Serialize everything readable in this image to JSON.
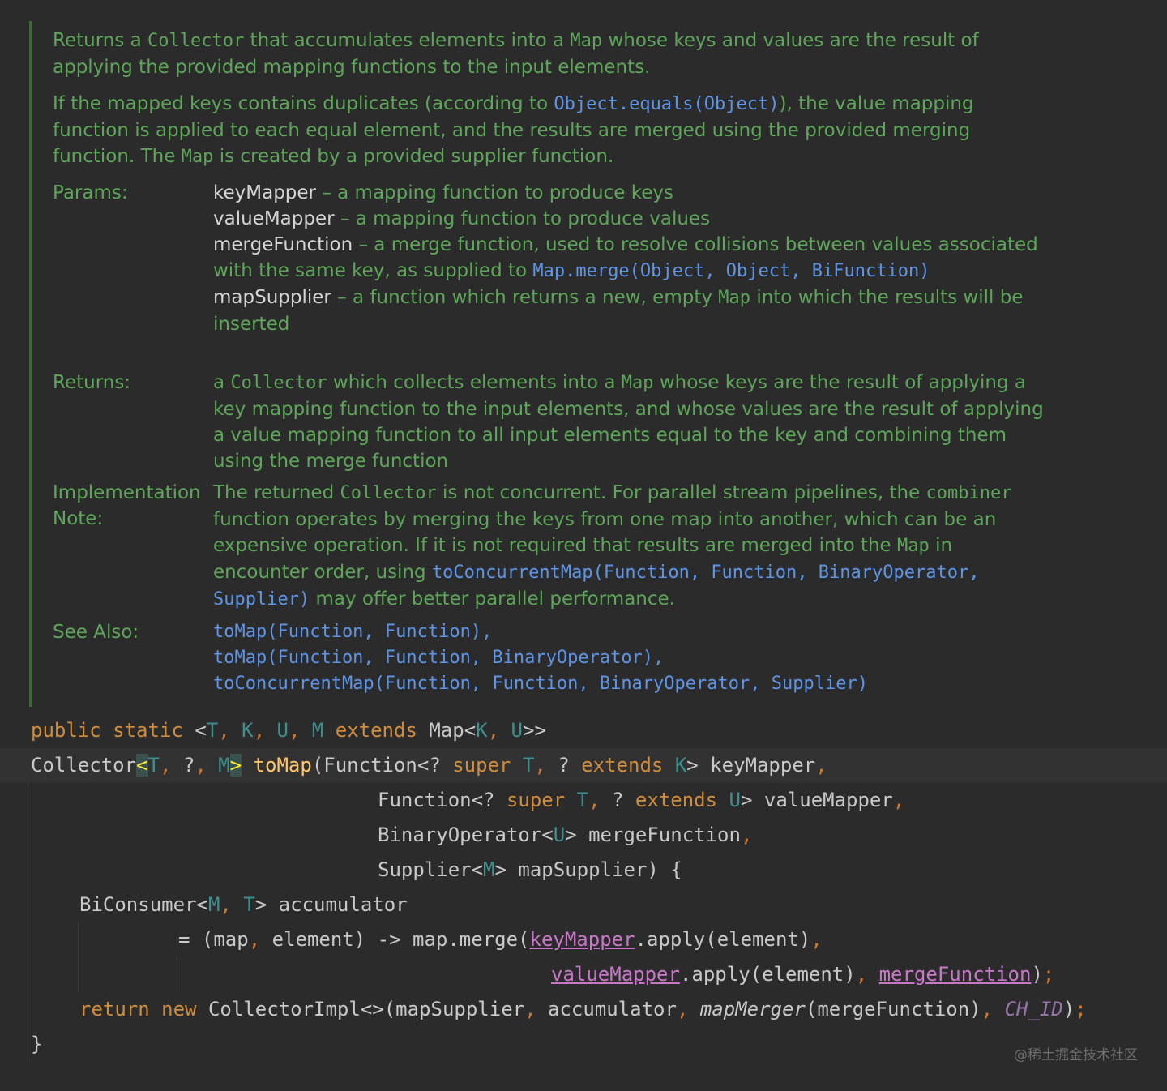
{
  "doc": {
    "p1_a": "Returns a ",
    "p1_b": "Collector",
    "p1_c": " that accumulates elements into a ",
    "p1_d": "Map",
    "p1_e": " whose keys and values are the result of applying the provided mapping functions to the input elements.",
    "p2_a": "If the mapped keys contains duplicates (according to ",
    "p2_link": "Object.equals(Object)",
    "p2_b": "), the value mapping function is applied to each equal element, and the results are merged using the provided merging function. The ",
    "p2_map": "Map",
    "p2_c": " is created by a provided supplier function.",
    "params_label": "Params:",
    "params": [
      {
        "name": "keyMapper",
        "desc": " – a mapping function to produce keys"
      },
      {
        "name": "valueMapper",
        "desc": " – a mapping function to produce values"
      },
      {
        "name": "mergeFunction",
        "desc": " – a merge function, used to resolve collisions between values associated with the same key, as supplied to ",
        "link": "Map.merge(Object, Object, BiFunction)"
      },
      {
        "name": "mapSupplier",
        "desc": " – a function which returns a new, empty ",
        "code": "Map",
        "desc2": " into which the results will be inserted"
      }
    ],
    "returns_label": "Returns:",
    "returns_a": "a ",
    "returns_collector": "Collector",
    "returns_b": " which collects elements into a ",
    "returns_map": "Map",
    "returns_c": " whose keys are the result of applying a key mapping function to the input elements, and whose values are the result of applying a value mapping function to all input elements equal to the key and combining them using the merge function",
    "impl_label_1": "Implementation",
    "impl_label_2": "Note:",
    "impl_a": "The returned ",
    "impl_collector": "Collector",
    "impl_b": " is not concurrent. For parallel stream pipelines, the ",
    "impl_combiner": "combiner",
    "impl_c": " function operates by merging the keys from one map into another, which can be an expensive operation. If it is not required that results are merged into the ",
    "impl_map": "Map",
    "impl_d": " in encounter order, using ",
    "impl_link": "toConcurrentMap(Function, Function, BinaryOperator, Supplier)",
    "impl_e": " may offer better parallel performance.",
    "see_label": "See Also:",
    "see": [
      "toMap(Function, Function),",
      "toMap(Function, Function, BinaryOperator),",
      "toConcurrentMap(Function, Function, BinaryOperator, Supplier)"
    ]
  },
  "code": {
    "public": "public",
    "static": "static",
    "lt": "<",
    "T": "T",
    "K": "K",
    "U": "U",
    "M": "M",
    "comma": ",",
    "extends": "extends",
    "Map": "Map",
    "gtgt": ">>",
    "Collector": "Collector",
    "q": "?",
    "gt": ">",
    "toMap": "toMap",
    "Function": "Function",
    "q_open": "(Function<?",
    "super": "super",
    "keyMapper": "keyMapper",
    "valueMapper": "valueMapper",
    "BinaryOperator": "BinaryOperator",
    "mergeFunction": "mergeFunction",
    "Supplier": "Supplier",
    "mapSupplier": "mapSupplier",
    "brace_open": ") {",
    "BiConsumer": "BiConsumer",
    "accumulator": "accumulator",
    "eq": "= ",
    "lambda_a": "(map",
    "lambda_b": " element) -> map.merge(",
    "apply_element": ".apply(element)",
    "semicolon": ";",
    "close_paren": ")",
    "return": "return",
    "new": "new",
    "CollectorImpl": "CollectorImpl<>(mapSupplier",
    "accumulator2": " accumulator",
    "mapMerger": "mapMerger",
    "mapMerger_arg": "(mergeFunction)",
    "CH_ID": "CH_ID",
    "close_brace": "}"
  },
  "watermark": "@稀土掘金技术社区"
}
